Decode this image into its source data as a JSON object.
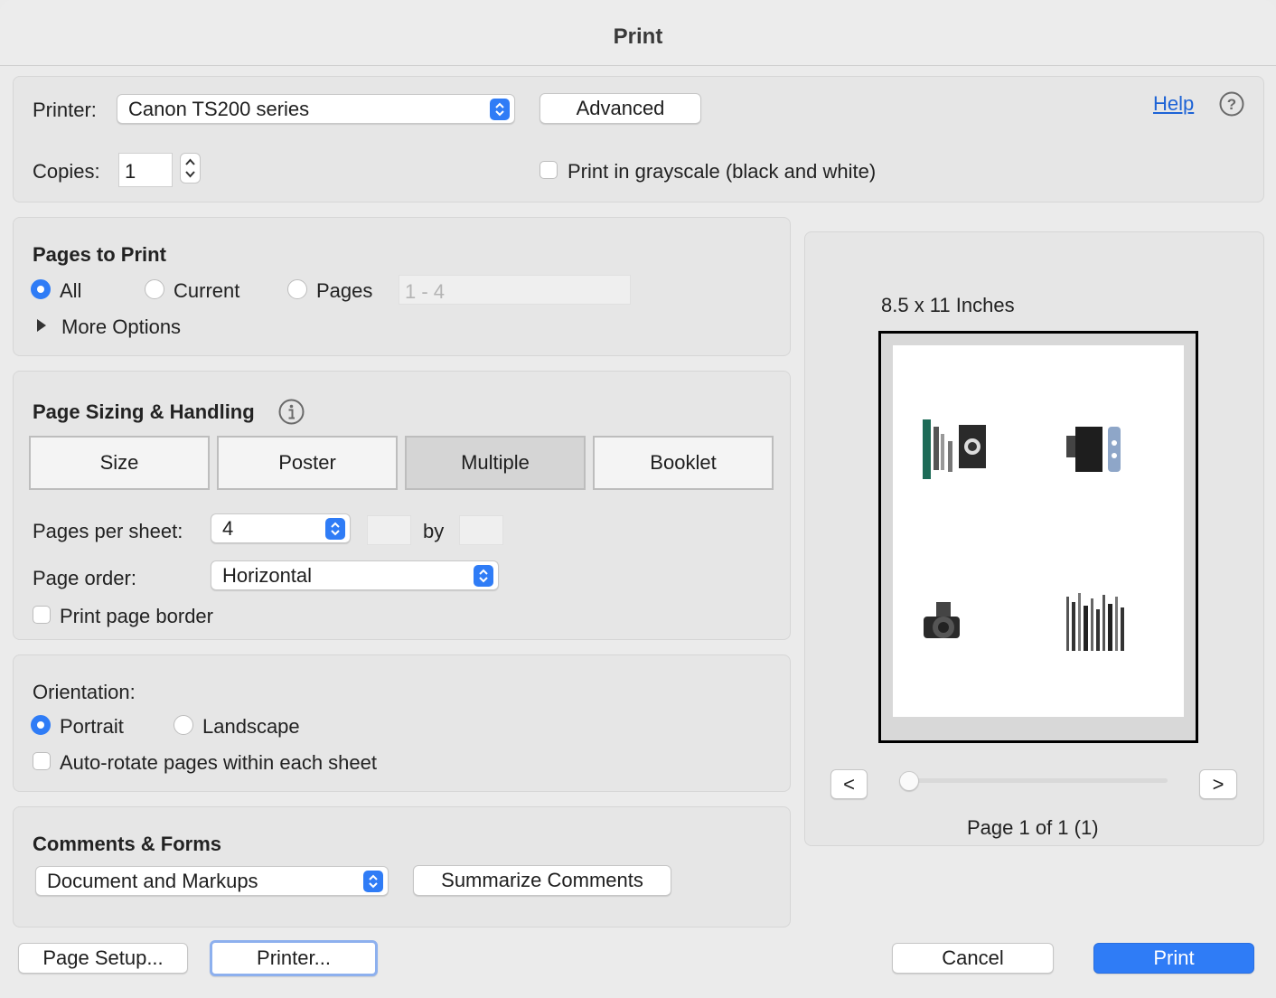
{
  "window": {
    "title": "Print"
  },
  "printer": {
    "label": "Printer:",
    "selected": "Canon TS200 series",
    "advanced_label": "Advanced",
    "help_label": "Help",
    "copies_label": "Copies:",
    "copies_value": "1",
    "grayscale_label": "Print in grayscale (black and white)",
    "grayscale_checked": false
  },
  "pages_to_print": {
    "title": "Pages to Print",
    "options": {
      "all": "All",
      "current": "Current",
      "pages": "Pages"
    },
    "selected": "all",
    "range_placeholder": "1 - 4",
    "more_options": "More Options"
  },
  "sizing": {
    "title": "Page Sizing & Handling",
    "tabs": [
      "Size",
      "Poster",
      "Multiple",
      "Booklet"
    ],
    "active_tab": "Multiple",
    "pages_per_sheet_label": "Pages per sheet:",
    "pages_per_sheet_value": "4",
    "by_label": "by",
    "page_order_label": "Page order:",
    "page_order_value": "Horizontal",
    "border_label": "Print page border",
    "border_checked": false
  },
  "orientation": {
    "label": "Orientation:",
    "portrait": "Portrait",
    "landscape": "Landscape",
    "selected": "portrait",
    "autorotate_label": "Auto-rotate pages within each sheet",
    "autorotate_checked": false
  },
  "comments": {
    "title": "Comments & Forms",
    "selected": "Document and Markups",
    "summarize_label": "Summarize Comments"
  },
  "preview": {
    "size_label": "8.5 x 11 Inches",
    "prev_label": "<",
    "next_label": ">",
    "page_status": "Page 1 of 1 (1)",
    "slider_position": 0
  },
  "footer": {
    "page_setup": "Page Setup...",
    "printer": "Printer...",
    "cancel": "Cancel",
    "print": "Print"
  },
  "colors": {
    "accent": "#2f7cf6",
    "link": "#1d63d6"
  }
}
